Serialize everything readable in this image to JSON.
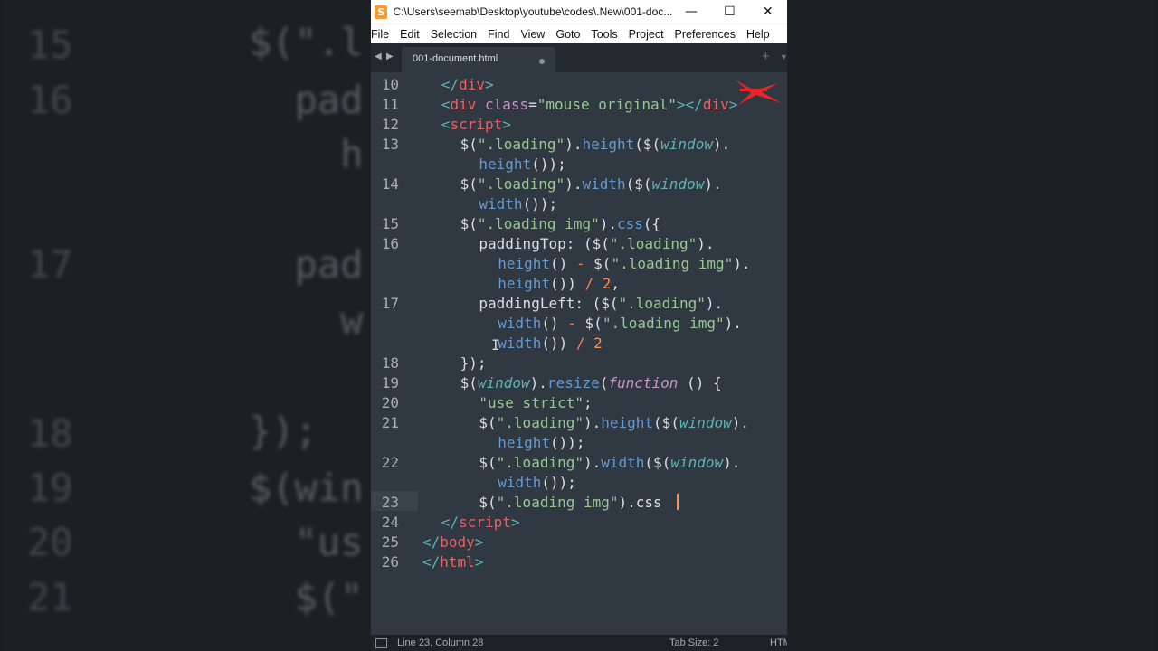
{
  "window": {
    "title": "C:\\Users\\seemab\\Desktop\\youtube\\codes\\.New\\001-doc...",
    "app_icon": "S"
  },
  "menu": [
    "File",
    "Edit",
    "Selection",
    "Find",
    "View",
    "Goto",
    "Tools",
    "Project",
    "Preferences",
    "Help"
  ],
  "tab": {
    "label": "001-document.html"
  },
  "status": {
    "position": "Line 23, Column 28",
    "tab_size": "Tab Size: 2",
    "syntax": "HTML"
  },
  "code_lines": [
    {
      "n": "10",
      "indent": 2,
      "segs": [
        [
          "c-br",
          "</"
        ],
        [
          "c-tag",
          "div"
        ],
        [
          "c-br",
          ">"
        ]
      ]
    },
    {
      "n": "11",
      "indent": 2,
      "segs": [
        [
          "c-br",
          "<"
        ],
        [
          "c-tag",
          "div "
        ],
        [
          "c-attr",
          "class"
        ],
        [
          "c-txt",
          "="
        ],
        [
          "c-str",
          "\"mouse original\""
        ],
        [
          "c-br",
          "></"
        ],
        [
          "c-tag",
          "div"
        ],
        [
          "c-br",
          ">"
        ]
      ]
    },
    {
      "n": "12",
      "indent": 2,
      "segs": [
        [
          "c-br",
          "<"
        ],
        [
          "c-tag",
          "script"
        ],
        [
          "c-br",
          ">"
        ]
      ]
    },
    {
      "n": "13",
      "indent": 4,
      "segs": [
        [
          "c-txt",
          "$("
        ],
        [
          "c-str",
          "\".loading\""
        ],
        [
          "c-txt",
          ")."
        ],
        [
          "c-fn",
          "height"
        ],
        [
          "c-txt",
          "($("
        ],
        [
          "c-obj",
          "window"
        ],
        [
          "c-txt",
          ")."
        ]
      ]
    },
    {
      "n": "",
      "indent": 6,
      "segs": [
        [
          "c-fn",
          "height"
        ],
        [
          "c-txt",
          "());"
        ]
      ]
    },
    {
      "n": "14",
      "indent": 4,
      "segs": [
        [
          "c-txt",
          "$("
        ],
        [
          "c-str",
          "\".loading\""
        ],
        [
          "c-txt",
          ")."
        ],
        [
          "c-fn",
          "width"
        ],
        [
          "c-txt",
          "($("
        ],
        [
          "c-obj",
          "window"
        ],
        [
          "c-txt",
          ")."
        ]
      ]
    },
    {
      "n": "",
      "indent": 6,
      "segs": [
        [
          "c-fn",
          "width"
        ],
        [
          "c-txt",
          "());"
        ]
      ]
    },
    {
      "n": "15",
      "indent": 4,
      "segs": [
        [
          "c-txt",
          "$("
        ],
        [
          "c-str",
          "\".loading img\""
        ],
        [
          "c-txt",
          ")."
        ],
        [
          "c-fn",
          "css"
        ],
        [
          "c-txt",
          "({"
        ]
      ]
    },
    {
      "n": "16",
      "indent": 6,
      "segs": [
        [
          "c-txt",
          "paddingTop: ($("
        ],
        [
          "c-str",
          "\".loading\""
        ],
        [
          "c-txt",
          ")."
        ]
      ]
    },
    {
      "n": "",
      "indent": 8,
      "segs": [
        [
          "c-fn",
          "height"
        ],
        [
          "c-txt",
          "() "
        ],
        [
          "c-op",
          "-"
        ],
        [
          "c-txt",
          " $("
        ],
        [
          "c-str",
          "\".loading img\""
        ],
        [
          "c-txt",
          ")."
        ]
      ]
    },
    {
      "n": "",
      "indent": 8,
      "segs": [
        [
          "c-fn",
          "height"
        ],
        [
          "c-txt",
          "()) "
        ],
        [
          "c-op",
          "/"
        ],
        [
          "c-txt",
          " "
        ],
        [
          "c-num",
          "2"
        ],
        [
          "c-txt",
          ","
        ]
      ]
    },
    {
      "n": "17",
      "indent": 6,
      "segs": [
        [
          "c-txt",
          "paddingLeft: ($("
        ],
        [
          "c-str",
          "\".loading\""
        ],
        [
          "c-txt",
          ")."
        ]
      ]
    },
    {
      "n": "",
      "indent": 8,
      "segs": [
        [
          "c-fn",
          "width"
        ],
        [
          "c-txt",
          "() "
        ],
        [
          "c-op",
          "-"
        ],
        [
          "c-txt",
          " $("
        ],
        [
          "c-str",
          "\".loading img\""
        ],
        [
          "c-txt",
          ")."
        ]
      ]
    },
    {
      "n": "",
      "indent": 8,
      "segs": [
        [
          "c-fn",
          "width"
        ],
        [
          "c-txt",
          "()) "
        ],
        [
          "c-op",
          "/"
        ],
        [
          "c-txt",
          " "
        ],
        [
          "c-num",
          "2"
        ]
      ]
    },
    {
      "n": "18",
      "indent": 4,
      "segs": [
        [
          "c-txt",
          "});"
        ]
      ]
    },
    {
      "n": "19",
      "indent": 4,
      "segs": [
        [
          "c-txt",
          "$("
        ],
        [
          "c-obj",
          "window"
        ],
        [
          "c-txt",
          ")."
        ],
        [
          "c-fn",
          "resize"
        ],
        [
          "c-txt",
          "("
        ],
        [
          "c-kw",
          "function"
        ],
        [
          "c-txt",
          " () {"
        ]
      ]
    },
    {
      "n": "20",
      "indent": 6,
      "segs": [
        [
          "c-str",
          "\"use strict\""
        ],
        [
          "c-txt",
          ";"
        ]
      ]
    },
    {
      "n": "21",
      "indent": 6,
      "segs": [
        [
          "c-txt",
          "$("
        ],
        [
          "c-str",
          "\".loading\""
        ],
        [
          "c-txt",
          ")."
        ],
        [
          "c-fn",
          "height"
        ],
        [
          "c-txt",
          "($("
        ],
        [
          "c-obj",
          "window"
        ],
        [
          "c-txt",
          ")."
        ]
      ]
    },
    {
      "n": "",
      "indent": 8,
      "segs": [
        [
          "c-fn",
          "height"
        ],
        [
          "c-txt",
          "());"
        ]
      ]
    },
    {
      "n": "22",
      "indent": 6,
      "segs": [
        [
          "c-txt",
          "$("
        ],
        [
          "c-str",
          "\".loading\""
        ],
        [
          "c-txt",
          ")."
        ],
        [
          "c-fn",
          "width"
        ],
        [
          "c-txt",
          "($("
        ],
        [
          "c-obj",
          "window"
        ],
        [
          "c-txt",
          ")."
        ]
      ]
    },
    {
      "n": "",
      "indent": 8,
      "segs": [
        [
          "c-fn",
          "width"
        ],
        [
          "c-txt",
          "());"
        ]
      ]
    },
    {
      "n": "23",
      "indent": 6,
      "segs": [
        [
          "c-txt",
          "$("
        ],
        [
          "c-str",
          "\".loading img\""
        ],
        [
          "c-txt",
          ")."
        ],
        [
          "c-txt",
          "css"
        ]
      ]
    },
    {
      "n": "24",
      "indent": 2,
      "segs": [
        [
          "c-br",
          "</"
        ],
        [
          "c-tag",
          "script"
        ],
        [
          "c-br",
          ">"
        ]
      ]
    },
    {
      "n": "25",
      "indent": 0,
      "segs": [
        [
          "c-br",
          "</"
        ],
        [
          "c-tag",
          "body"
        ],
        [
          "c-br",
          ">"
        ]
      ]
    },
    {
      "n": "26",
      "indent": 0,
      "segs": [
        [
          "c-br",
          "</"
        ],
        [
          "c-tag",
          "html"
        ],
        [
          "c-br",
          ">"
        ]
      ]
    }
  ],
  "background": {
    "line_numbers": [
      "15",
      "16",
      "17",
      "18",
      "19",
      "20",
      "21"
    ],
    "snippets": [
      "$(\".l",
      "  pad",
      "    h",
      "  pad",
      "    w",
      "});",
      "$(win",
      "  \"us",
      "  $(\""
    ]
  },
  "colors": {
    "editor_bg": "#303841",
    "accent_red": "#e8262a",
    "cursor": "#f99157"
  }
}
